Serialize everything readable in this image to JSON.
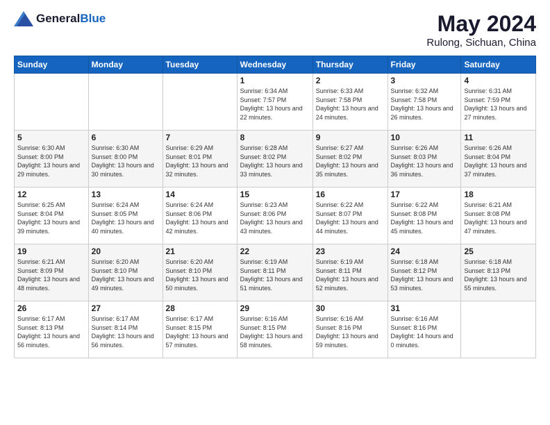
{
  "logo": {
    "general": "General",
    "blue": "Blue"
  },
  "title": {
    "month_year": "May 2024",
    "location": "Rulong, Sichuan, China"
  },
  "days_of_week": [
    "Sunday",
    "Monday",
    "Tuesday",
    "Wednesday",
    "Thursday",
    "Friday",
    "Saturday"
  ],
  "weeks": [
    [
      {
        "day": "",
        "sunrise": "",
        "sunset": "",
        "daylight": ""
      },
      {
        "day": "",
        "sunrise": "",
        "sunset": "",
        "daylight": ""
      },
      {
        "day": "",
        "sunrise": "",
        "sunset": "",
        "daylight": ""
      },
      {
        "day": "1",
        "sunrise": "Sunrise: 6:34 AM",
        "sunset": "Sunset: 7:57 PM",
        "daylight": "Daylight: 13 hours and 22 minutes."
      },
      {
        "day": "2",
        "sunrise": "Sunrise: 6:33 AM",
        "sunset": "Sunset: 7:58 PM",
        "daylight": "Daylight: 13 hours and 24 minutes."
      },
      {
        "day": "3",
        "sunrise": "Sunrise: 6:32 AM",
        "sunset": "Sunset: 7:58 PM",
        "daylight": "Daylight: 13 hours and 26 minutes."
      },
      {
        "day": "4",
        "sunrise": "Sunrise: 6:31 AM",
        "sunset": "Sunset: 7:59 PM",
        "daylight": "Daylight: 13 hours and 27 minutes."
      }
    ],
    [
      {
        "day": "5",
        "sunrise": "Sunrise: 6:30 AM",
        "sunset": "Sunset: 8:00 PM",
        "daylight": "Daylight: 13 hours and 29 minutes."
      },
      {
        "day": "6",
        "sunrise": "Sunrise: 6:30 AM",
        "sunset": "Sunset: 8:00 PM",
        "daylight": "Daylight: 13 hours and 30 minutes."
      },
      {
        "day": "7",
        "sunrise": "Sunrise: 6:29 AM",
        "sunset": "Sunset: 8:01 PM",
        "daylight": "Daylight: 13 hours and 32 minutes."
      },
      {
        "day": "8",
        "sunrise": "Sunrise: 6:28 AM",
        "sunset": "Sunset: 8:02 PM",
        "daylight": "Daylight: 13 hours and 33 minutes."
      },
      {
        "day": "9",
        "sunrise": "Sunrise: 6:27 AM",
        "sunset": "Sunset: 8:02 PM",
        "daylight": "Daylight: 13 hours and 35 minutes."
      },
      {
        "day": "10",
        "sunrise": "Sunrise: 6:26 AM",
        "sunset": "Sunset: 8:03 PM",
        "daylight": "Daylight: 13 hours and 36 minutes."
      },
      {
        "day": "11",
        "sunrise": "Sunrise: 6:26 AM",
        "sunset": "Sunset: 8:04 PM",
        "daylight": "Daylight: 13 hours and 37 minutes."
      }
    ],
    [
      {
        "day": "12",
        "sunrise": "Sunrise: 6:25 AM",
        "sunset": "Sunset: 8:04 PM",
        "daylight": "Daylight: 13 hours and 39 minutes."
      },
      {
        "day": "13",
        "sunrise": "Sunrise: 6:24 AM",
        "sunset": "Sunset: 8:05 PM",
        "daylight": "Daylight: 13 hours and 40 minutes."
      },
      {
        "day": "14",
        "sunrise": "Sunrise: 6:24 AM",
        "sunset": "Sunset: 8:06 PM",
        "daylight": "Daylight: 13 hours and 42 minutes."
      },
      {
        "day": "15",
        "sunrise": "Sunrise: 6:23 AM",
        "sunset": "Sunset: 8:06 PM",
        "daylight": "Daylight: 13 hours and 43 minutes."
      },
      {
        "day": "16",
        "sunrise": "Sunrise: 6:22 AM",
        "sunset": "Sunset: 8:07 PM",
        "daylight": "Daylight: 13 hours and 44 minutes."
      },
      {
        "day": "17",
        "sunrise": "Sunrise: 6:22 AM",
        "sunset": "Sunset: 8:08 PM",
        "daylight": "Daylight: 13 hours and 45 minutes."
      },
      {
        "day": "18",
        "sunrise": "Sunrise: 6:21 AM",
        "sunset": "Sunset: 8:08 PM",
        "daylight": "Daylight: 13 hours and 47 minutes."
      }
    ],
    [
      {
        "day": "19",
        "sunrise": "Sunrise: 6:21 AM",
        "sunset": "Sunset: 8:09 PM",
        "daylight": "Daylight: 13 hours and 48 minutes."
      },
      {
        "day": "20",
        "sunrise": "Sunrise: 6:20 AM",
        "sunset": "Sunset: 8:10 PM",
        "daylight": "Daylight: 13 hours and 49 minutes."
      },
      {
        "day": "21",
        "sunrise": "Sunrise: 6:20 AM",
        "sunset": "Sunset: 8:10 PM",
        "daylight": "Daylight: 13 hours and 50 minutes."
      },
      {
        "day": "22",
        "sunrise": "Sunrise: 6:19 AM",
        "sunset": "Sunset: 8:11 PM",
        "daylight": "Daylight: 13 hours and 51 minutes."
      },
      {
        "day": "23",
        "sunrise": "Sunrise: 6:19 AM",
        "sunset": "Sunset: 8:11 PM",
        "daylight": "Daylight: 13 hours and 52 minutes."
      },
      {
        "day": "24",
        "sunrise": "Sunrise: 6:18 AM",
        "sunset": "Sunset: 8:12 PM",
        "daylight": "Daylight: 13 hours and 53 minutes."
      },
      {
        "day": "25",
        "sunrise": "Sunrise: 6:18 AM",
        "sunset": "Sunset: 8:13 PM",
        "daylight": "Daylight: 13 hours and 55 minutes."
      }
    ],
    [
      {
        "day": "26",
        "sunrise": "Sunrise: 6:17 AM",
        "sunset": "Sunset: 8:13 PM",
        "daylight": "Daylight: 13 hours and 56 minutes."
      },
      {
        "day": "27",
        "sunrise": "Sunrise: 6:17 AM",
        "sunset": "Sunset: 8:14 PM",
        "daylight": "Daylight: 13 hours and 56 minutes."
      },
      {
        "day": "28",
        "sunrise": "Sunrise: 6:17 AM",
        "sunset": "Sunset: 8:15 PM",
        "daylight": "Daylight: 13 hours and 57 minutes."
      },
      {
        "day": "29",
        "sunrise": "Sunrise: 6:16 AM",
        "sunset": "Sunset: 8:15 PM",
        "daylight": "Daylight: 13 hours and 58 minutes."
      },
      {
        "day": "30",
        "sunrise": "Sunrise: 6:16 AM",
        "sunset": "Sunset: 8:16 PM",
        "daylight": "Daylight: 13 hours and 59 minutes."
      },
      {
        "day": "31",
        "sunrise": "Sunrise: 6:16 AM",
        "sunset": "Sunset: 8:16 PM",
        "daylight": "Daylight: 14 hours and 0 minutes."
      },
      {
        "day": "",
        "sunrise": "",
        "sunset": "",
        "daylight": ""
      }
    ]
  ]
}
